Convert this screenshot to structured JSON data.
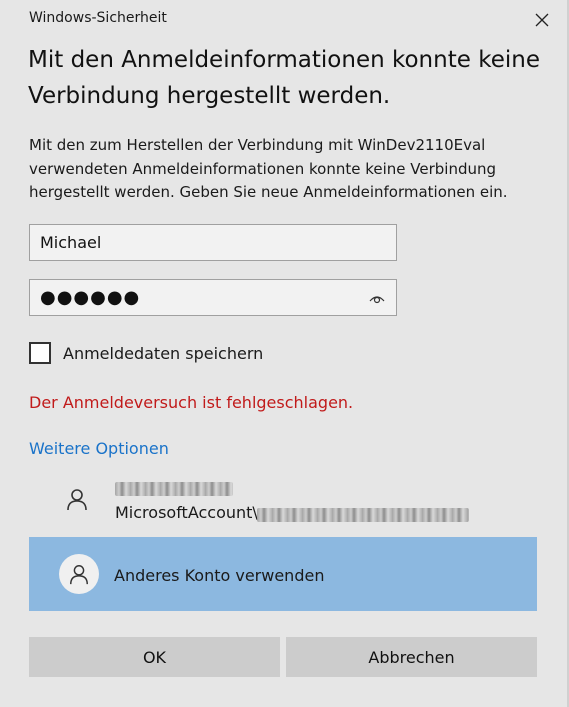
{
  "window": {
    "title": "Windows-Sicherheit",
    "close_icon": "close-icon"
  },
  "heading": "Mit den Anmeldeinformationen konnte keine Verbindung hergestellt werden.",
  "description": "Mit den zum Herstellen der Verbindung mit WinDev2110Eval verwendeten Anmeldeinformationen konnte keine Verbindung hergestellt werden. Geben Sie neue Anmeldeinformationen ein.",
  "username": {
    "value": "Michael"
  },
  "password": {
    "value": "●●●●●●",
    "reveal_icon": "eye-icon"
  },
  "remember": {
    "label": "Anmeldedaten speichern",
    "checked": false
  },
  "error": "Der Anmeldeversuch ist fehlgeschlagen.",
  "more_options": "Weitere Optionen",
  "accounts": {
    "ms_account": {
      "prefix": "MicrosoftAccount\\",
      "icon": "person-icon"
    },
    "other": {
      "label": "Anderes Konto verwenden",
      "icon": "person-icon"
    }
  },
  "buttons": {
    "ok": "OK",
    "cancel": "Abbrechen"
  },
  "colors": {
    "background": "#e6e6e6",
    "error": "#c11a1a",
    "link": "#1a73c9",
    "selected_account": "#8cb8e0",
    "button": "#cccccc"
  }
}
